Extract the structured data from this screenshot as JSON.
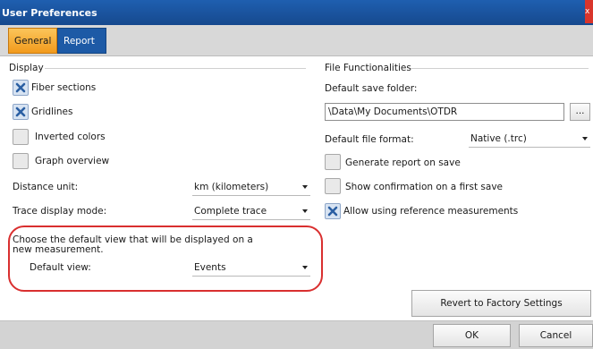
{
  "window": {
    "title": "User Preferences",
    "close_glyph": "x"
  },
  "tabs": [
    {
      "label": "General",
      "active": true
    },
    {
      "label": "Report",
      "active": false
    }
  ],
  "display": {
    "group_label": "Display",
    "checkboxes": [
      {
        "label": "Fiber sections",
        "checked": true
      },
      {
        "label": "Gridlines",
        "checked": true
      },
      {
        "label": "Inverted colors",
        "checked": false
      },
      {
        "label": "Graph overview",
        "checked": false
      }
    ],
    "distance_unit": {
      "label": "Distance unit:",
      "value": "km (kilometers)"
    },
    "trace_display_mode": {
      "label": "Trace display mode:",
      "value": "Complete trace"
    },
    "default_view_note": "Choose the default view that will be displayed on a new measurement.",
    "default_view": {
      "label": "Default view:",
      "value": "Events"
    }
  },
  "file_functionalities": {
    "group_label": "File Functionalities",
    "save_folder": {
      "label": "Default save folder:",
      "value": "\\Data\\My Documents\\OTDR",
      "browse_label": "..."
    },
    "file_format": {
      "label": "Default file format:",
      "value": "Native (.trc)"
    },
    "checkboxes": [
      {
        "label": "Generate report on save",
        "checked": false
      },
      {
        "label": "Show confirmation on a first save",
        "checked": false
      },
      {
        "label": "Allow using reference measurements",
        "checked": true
      }
    ]
  },
  "buttons": {
    "revert": "Revert to Factory Settings",
    "ok": "OK",
    "cancel": "Cancel"
  },
  "colors": {
    "title_bar": "#1f5fb0",
    "active_tab": "#f29a1c",
    "inactive_tab": "#1d5aa6",
    "highlight": "#d92f2f"
  }
}
